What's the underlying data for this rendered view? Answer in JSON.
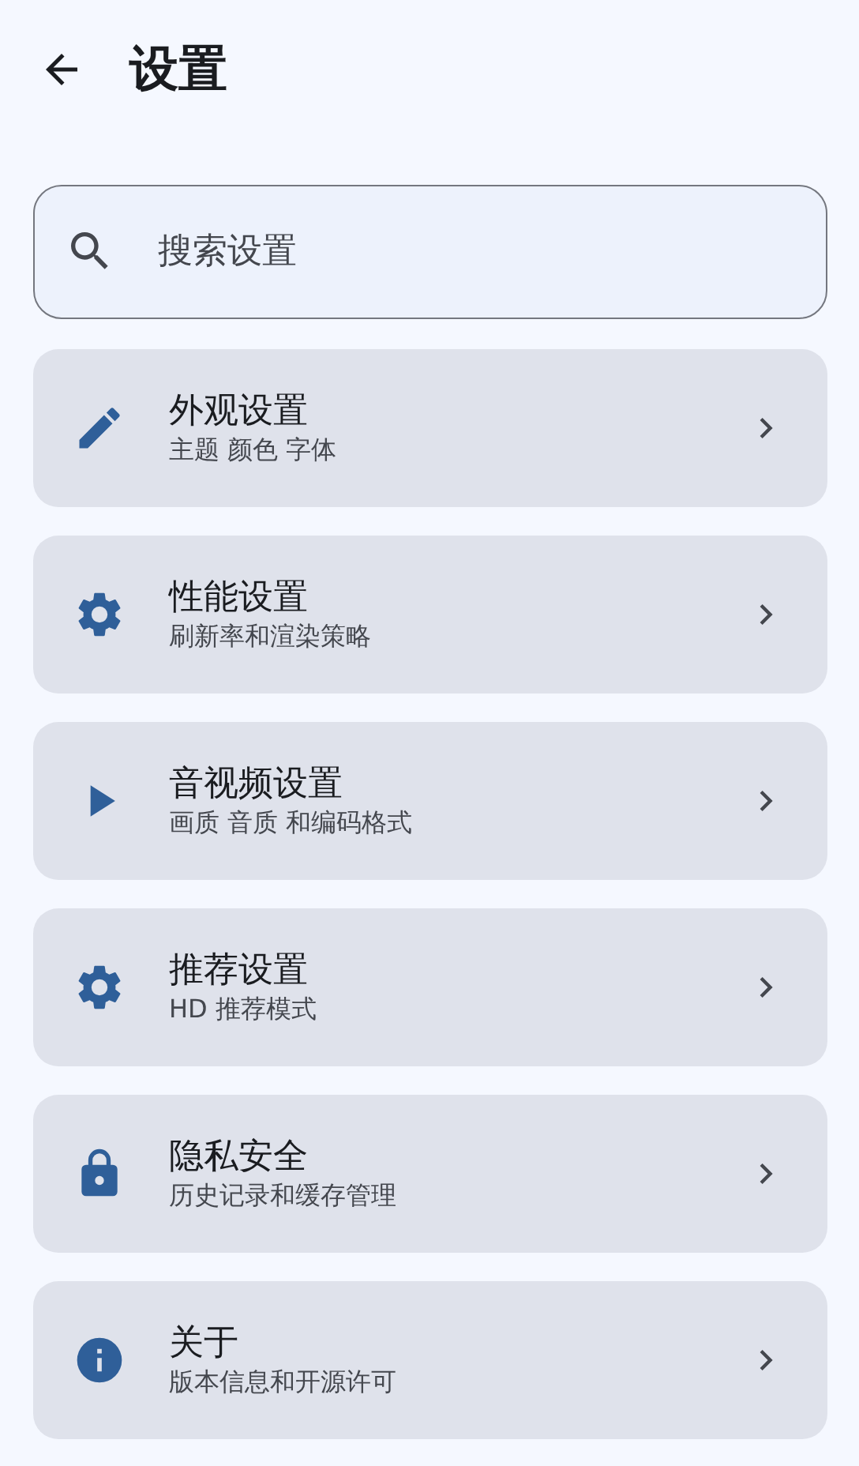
{
  "header": {
    "title": "设置"
  },
  "search": {
    "placeholder": "搜索设置"
  },
  "items": [
    {
      "title": "外观设置",
      "subtitle": "主题 颜色 字体"
    },
    {
      "title": "性能设置",
      "subtitle": "刷新率和渲染策略"
    },
    {
      "title": "音视频设置",
      "subtitle": "画质 音质 和编码格式"
    },
    {
      "title": "推荐设置",
      "subtitle": "HD 推荐模式"
    },
    {
      "title": "隐私安全",
      "subtitle": "历史记录和缓存管理"
    },
    {
      "title": "关于",
      "subtitle": "版本信息和开源许可"
    }
  ]
}
